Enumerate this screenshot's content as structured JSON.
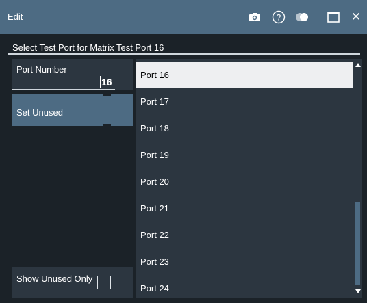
{
  "window": {
    "title": "Edit",
    "icons": [
      "camera-icon",
      "help-icon",
      "toggle-icon",
      "maximize-icon",
      "close-icon"
    ],
    "help_glyph": "?",
    "close_glyph": "✕"
  },
  "header": {
    "title": "Select Test Port for Matrix Test Port 16"
  },
  "port_number": {
    "label": "Port Number",
    "value": "16"
  },
  "set_unused": {
    "label": "Set Unused"
  },
  "show_unused_only": {
    "label": "Show Unused Only",
    "checked": false
  },
  "port_list": {
    "selected": "Port 16",
    "items": [
      "Port 16",
      "Port 17",
      "Port 18",
      "Port 19",
      "Port 20",
      "Port 21",
      "Port 22",
      "Port 23",
      "Port 24"
    ]
  },
  "colors": {
    "title_bar": "#4d6b83",
    "background": "#1b2228",
    "panel": "#2c3640",
    "selected_item": "#eeeff1",
    "accent_button": "#4d6b83"
  }
}
